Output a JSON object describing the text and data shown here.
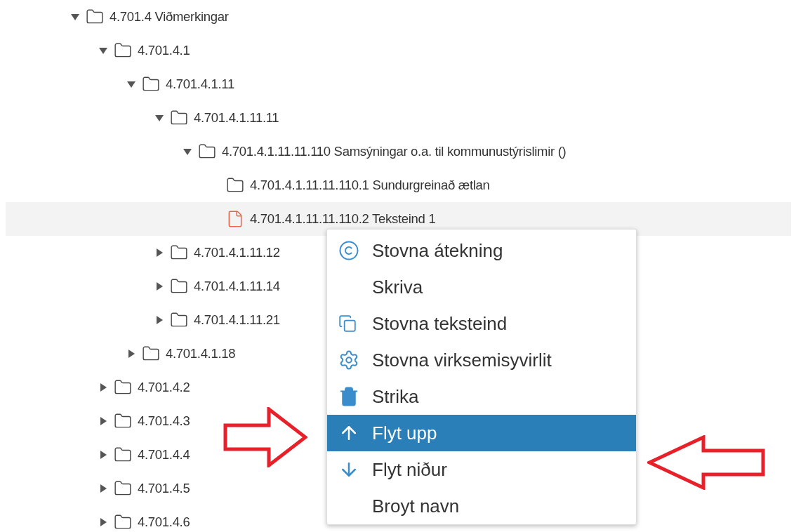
{
  "tree": [
    {
      "label": "4.701.4 Viðmerkingar",
      "kind": "folder",
      "expanded": true,
      "selected": false,
      "children": [
        {
          "label": "4.701.4.1",
          "kind": "folder",
          "expanded": true,
          "selected": false,
          "children": [
            {
              "label": "4.701.4.1.11",
              "kind": "folder",
              "expanded": true,
              "selected": false,
              "children": [
                {
                  "label": "4.701.4.1.11.11",
                  "kind": "folder",
                  "expanded": true,
                  "selected": false,
                  "children": [
                    {
                      "label": "4.701.4.1.11.11.110 Samsýningar o.a. til kommunustýrislimir ()",
                      "kind": "folder",
                      "expanded": true,
                      "selected": false,
                      "children": [
                        {
                          "label": "4.701.4.1.11.11.110.1 Sundurgreinað ætlan",
                          "kind": "folder",
                          "selected": false
                        },
                        {
                          "label": "4.701.4.1.11.11.110.2 Teksteind 1",
                          "kind": "file",
                          "selected": true
                        }
                      ]
                    }
                  ]
                },
                {
                  "label": "4.701.4.1.11.12",
                  "kind": "folder",
                  "expanded": false,
                  "selected": false
                },
                {
                  "label": "4.701.4.1.11.14",
                  "kind": "folder",
                  "expanded": false,
                  "selected": false
                },
                {
                  "label": "4.701.4.1.11.21",
                  "kind": "folder",
                  "expanded": false,
                  "selected": false
                }
              ]
            },
            {
              "label": "4.701.4.1.18",
              "kind": "folder",
              "expanded": false,
              "selected": false
            }
          ]
        },
        {
          "label": "4.701.4.2",
          "kind": "folder",
          "expanded": false,
          "selected": false
        },
        {
          "label": "4.701.4.3",
          "kind": "folder",
          "expanded": false,
          "selected": false
        },
        {
          "label": "4.701.4.4",
          "kind": "folder",
          "expanded": false,
          "selected": false
        },
        {
          "label": "4.701.4.5",
          "kind": "folder",
          "expanded": false,
          "selected": false
        },
        {
          "label": "4.701.4.6",
          "kind": "folder",
          "expanded": false,
          "selected": false
        }
      ]
    }
  ],
  "context_menu": {
    "items": [
      {
        "label": "Stovna átekning",
        "kind": "copyright",
        "selected": false
      },
      {
        "label": "Skriva",
        "kind": "none",
        "selected": false
      },
      {
        "label": "Stovna teksteind",
        "kind": "copy",
        "selected": false
      },
      {
        "label": "Stovna virksemisyvirlit",
        "kind": "gear",
        "selected": false
      },
      {
        "label": "Strika",
        "kind": "trash",
        "selected": false
      },
      {
        "label": "Flyt upp",
        "kind": "up",
        "selected": true
      },
      {
        "label": "Flyt niður",
        "kind": "down",
        "selected": false
      },
      {
        "label": "Broyt navn",
        "kind": "none",
        "selected": false
      }
    ]
  }
}
